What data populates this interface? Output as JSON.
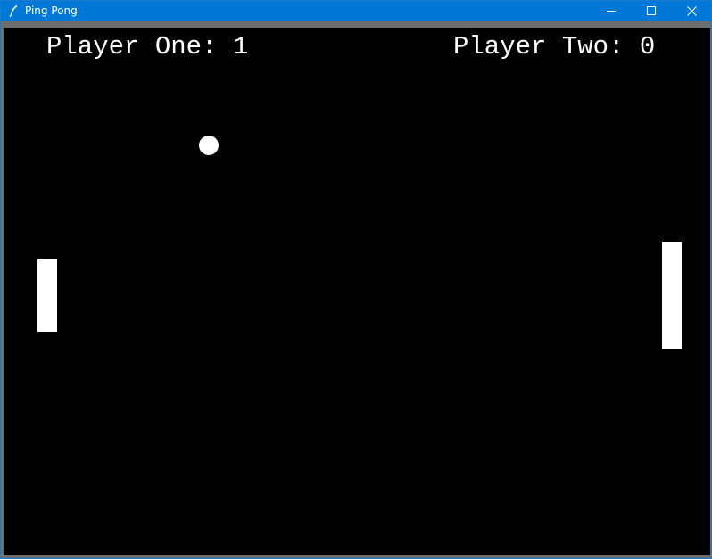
{
  "window": {
    "title": "Ping Pong",
    "icon": "feather-icon",
    "controls": [
      "minimize-icon",
      "maximize-icon",
      "close-icon"
    ]
  },
  "colors": {
    "titlebar": "#0078d7",
    "background": "#000000",
    "foreground": "#ffffff"
  },
  "scoreboard": {
    "player_one": "Player One: 1",
    "player_two": "Player Two: 0"
  }
}
